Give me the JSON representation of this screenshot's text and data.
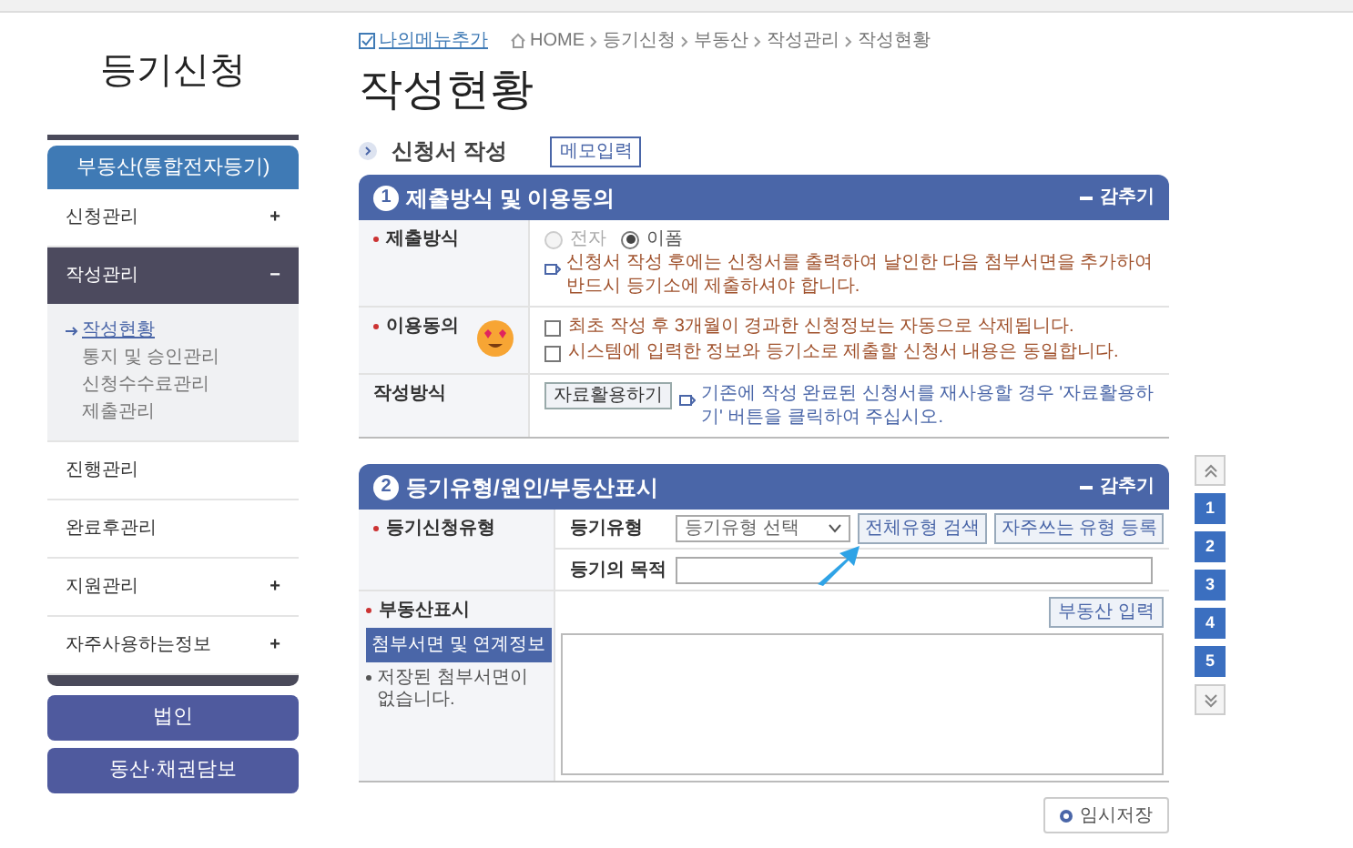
{
  "sidebar": {
    "title": "등기신청",
    "category": "부동산(통합전자등기)",
    "items": [
      {
        "label": "신청관리",
        "toggle": "+",
        "expanded": false
      },
      {
        "label": "작성관리",
        "toggle": "−",
        "expanded": true,
        "children": [
          {
            "label": "작성현황",
            "selected": true
          },
          {
            "label": "통지 및 승인관리",
            "selected": false
          },
          {
            "label": "신청수수료관리",
            "selected": false
          },
          {
            "label": "제출관리",
            "selected": false
          }
        ]
      },
      {
        "label": "진행관리",
        "expanded": false
      },
      {
        "label": "완료후관리",
        "expanded": false
      },
      {
        "label": "지원관리",
        "toggle": "+",
        "expanded": false
      },
      {
        "label": "자주사용하는정보",
        "toggle": "+",
        "expanded": false
      }
    ],
    "buttons": [
      "법인",
      "동산·채권담보"
    ]
  },
  "breadcrumb": {
    "my_menu": "나의메뉴추가",
    "items": [
      "HOME",
      "등기신청",
      "부동산",
      "작성관리",
      "작성현황"
    ]
  },
  "page_title": "작성현황",
  "section": {
    "title": "신청서 작성",
    "memo_button": "메모입력"
  },
  "panel1": {
    "number": "1",
    "title": "제출방식 및 이용동의",
    "collapse": "감추기",
    "method": {
      "label": "제출방식",
      "options": [
        {
          "label": "전자",
          "selected": false,
          "disabled": true
        },
        {
          "label": "이폼",
          "selected": true,
          "disabled": false
        }
      ],
      "note": "신청서 작성 후에는 신청서를 출력하여 날인한 다음 첨부서면을 추가하여 반드시 등기소에 제출하셔야 합니다."
    },
    "consent": {
      "label": "이용동의",
      "checks": [
        {
          "label": "최초 작성 후 3개월이 경과한 신청정보는 자동으로 삭제됩니다.",
          "checked": false
        },
        {
          "label": "시스템에 입력한 정보와 등기소로 제출할 신청서 내용은 동일합니다.",
          "checked": false
        }
      ]
    },
    "write": {
      "label": "작성방식",
      "button": "자료활용하기",
      "note": "기존에 작성 완료된 신청서를 재사용할 경우 '자료활용하기' 버튼을 클릭하여 주십시오."
    }
  },
  "panel2": {
    "number": "2",
    "title": "등기유형/원인/부동산표시",
    "collapse": "감추기",
    "type_row": {
      "label": "등기신청유형",
      "type_label": "등기유형",
      "select": "등기유형 선택",
      "search_button": "전체유형 검색",
      "favorite_button": "자주쓰는 유형 등록",
      "purpose_label": "등기의 목적"
    },
    "property": {
      "label": "부동산표시",
      "attach_button": "첨부서면 및 연계정보",
      "note": "저장된 첨부서면이 없습니다.",
      "input_button": "부동산 입력"
    }
  },
  "page_nav": [
    "1",
    "2",
    "3",
    "4",
    "5"
  ],
  "save_button": "임시저장"
}
